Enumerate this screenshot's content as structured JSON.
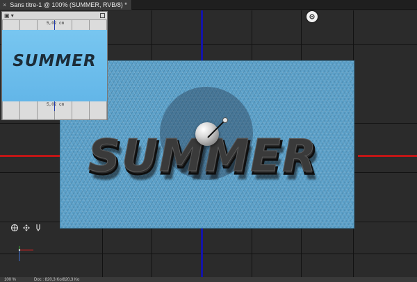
{
  "document": {
    "tab_title": "Sans titre-1 @ 100% (SUMMER, RVB/8) *",
    "close_glyph": "×"
  },
  "scene": {
    "text_3d": "SUMMER",
    "plane_color": "#5a9fc8",
    "axis_x_color": "#c01616",
    "axis_z_color": "#1414a8"
  },
  "preview": {
    "ruler_top_label": "5,02 cm",
    "ruler_bottom_label": "5,02 cm",
    "preview_text": "SUMMER"
  },
  "status": {
    "zoom": "100 %",
    "doc_size": "Doc : 820,3 Ko/820,3 Ko"
  },
  "icons": [
    "close-icon",
    "panel-menu-icon",
    "rotate-3d-icon",
    "pan-3d-icon",
    "zoom-3d-icon",
    "axis-gizmo-icon",
    "cursor-icon"
  ]
}
